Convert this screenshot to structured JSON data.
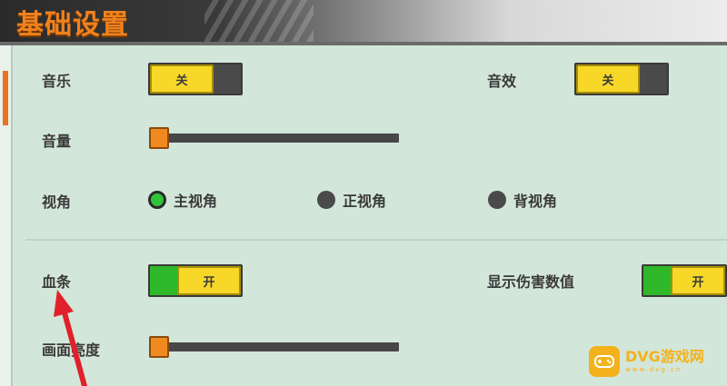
{
  "title": "基础设置",
  "music": {
    "label": "音乐",
    "state_text": "关"
  },
  "sound_effect": {
    "label": "音效",
    "state_text": "关"
  },
  "volume": {
    "label": "音量",
    "level": 0
  },
  "view": {
    "label": "视角",
    "options": [
      {
        "label": "主视角",
        "selected": true
      },
      {
        "label": "正视角",
        "selected": false
      },
      {
        "label": "背视角",
        "selected": false
      }
    ]
  },
  "health_bar": {
    "label": "血条",
    "state_text": "开"
  },
  "show_damage": {
    "label": "显示伤害数值",
    "state_text": "开"
  },
  "brightness": {
    "label": "画面亮度",
    "level": 0
  },
  "watermark": {
    "name": "DVG游戏网",
    "url": "www.dvg.cn"
  },
  "colors": {
    "accent_orange": "#f08a1e",
    "toggle_yellow": "#f7d829",
    "toggle_green": "#2fb82a",
    "panel_bg": "#d3e6da"
  }
}
